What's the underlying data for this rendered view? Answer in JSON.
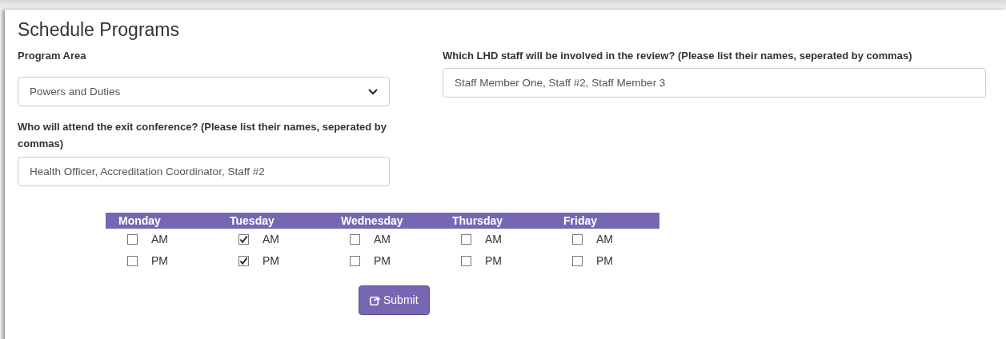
{
  "title": "Schedule Programs",
  "program_area": {
    "label": "Program Area",
    "value": "Powers and Duties"
  },
  "staff_involved": {
    "label": "Which LHD staff will be involved in the review? (Please list their names, seperated by commas)",
    "value": "Staff Member One, Staff #2, Staff Member 3"
  },
  "exit_conference": {
    "label": "Who will attend the exit conference? (Please list their names, seperated by commas)",
    "value": "Health Officer, Accreditation Coordinator, Staff #2"
  },
  "schedule": [
    {
      "day": "Monday",
      "slots": [
        {
          "label": "AM",
          "checked": false
        },
        {
          "label": "PM",
          "checked": false
        }
      ]
    },
    {
      "day": "Tuesday",
      "slots": [
        {
          "label": "AM",
          "checked": true
        },
        {
          "label": "PM",
          "checked": true
        }
      ]
    },
    {
      "day": "Wednesday",
      "slots": [
        {
          "label": "AM",
          "checked": false
        },
        {
          "label": "PM",
          "checked": false
        }
      ]
    },
    {
      "day": "Thursday",
      "slots": [
        {
          "label": "AM",
          "checked": false
        },
        {
          "label": "PM",
          "checked": false
        }
      ]
    },
    {
      "day": "Friday",
      "slots": [
        {
          "label": "AM",
          "checked": false
        },
        {
          "label": "PM",
          "checked": false
        }
      ]
    }
  ],
  "submit": {
    "label": "Submit"
  }
}
